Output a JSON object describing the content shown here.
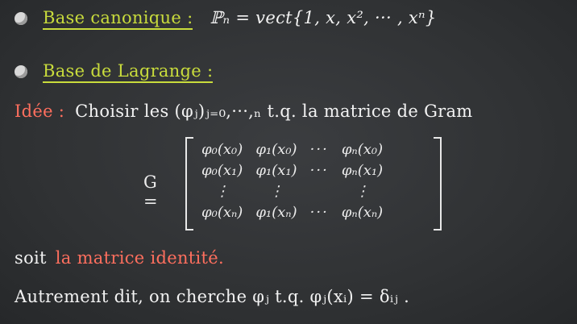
{
  "line1": {
    "label": "Base canonique :",
    "formula": "ℙₙ = vect{1, x, x², ··· , xⁿ}"
  },
  "line2": {
    "label": "Base de Lagrange :"
  },
  "line3": {
    "prefix": "Idée :",
    "text": "Choisir les (φⱼ)ⱼ₌₀,···,ₙ t.q. la matrice de Gram"
  },
  "matrix": {
    "name": "G =",
    "rows": [
      [
        "φ₀(x₀)",
        "φ₁(x₀)",
        "···",
        "φₙ(x₀)"
      ],
      [
        "φ₀(x₁)",
        "φ₁(x₁)",
        "···",
        "φₙ(x₁)"
      ],
      [
        "⋮",
        "⋮",
        "",
        "⋮"
      ],
      [
        "φ₀(xₙ)",
        "φ₁(xₙ)",
        "···",
        "φₙ(xₙ)"
      ]
    ]
  },
  "line4": {
    "prefix": "soit",
    "highlight": "la matrice identité."
  },
  "line5": {
    "text": "Autrement dit, on cherche φⱼ  t.q. φⱼ(xᵢ) = δᵢⱼ ."
  }
}
